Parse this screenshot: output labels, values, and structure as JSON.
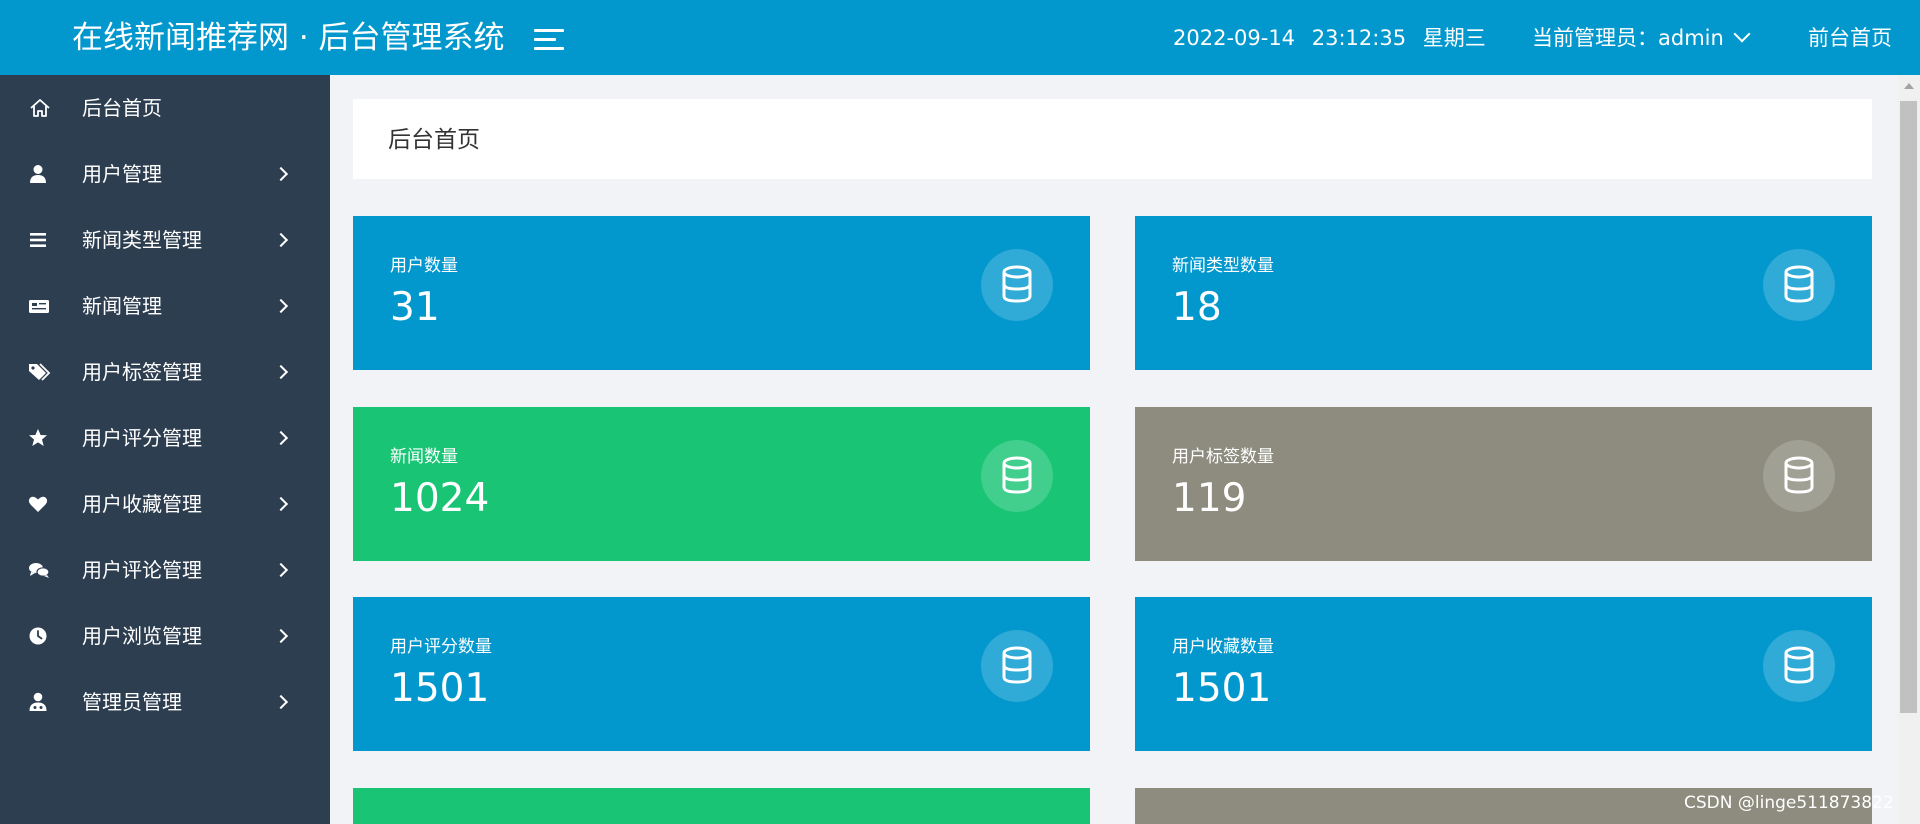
{
  "header": {
    "title": "在线新闻推荐网 · 后台管理系统",
    "date": "2022-09-14",
    "time": "23:12:35",
    "weekday": "星期三",
    "admin_label": "当前管理员：admin",
    "front_link": "前台首页"
  },
  "sidebar": {
    "items": [
      {
        "label": "后台首页",
        "icon": "home-icon"
      },
      {
        "label": "用户管理",
        "icon": "user-icon"
      },
      {
        "label": "新闻类型管理",
        "icon": "list-icon"
      },
      {
        "label": "新闻管理",
        "icon": "newspaper-icon"
      },
      {
        "label": "用户标签管理",
        "icon": "tags-icon"
      },
      {
        "label": "用户评分管理",
        "icon": "star-icon"
      },
      {
        "label": "用户收藏管理",
        "icon": "heart-icon"
      },
      {
        "label": "用户评论管理",
        "icon": "comments-icon"
      },
      {
        "label": "用户浏览管理",
        "icon": "clock-icon"
      },
      {
        "label": "管理员管理",
        "icon": "admin-user-icon"
      }
    ]
  },
  "main": {
    "page_title": "后台首页",
    "cards": [
      {
        "label": "用户数量",
        "value": "31",
        "color": "#0398cd",
        "icon": "database-icon"
      },
      {
        "label": "新闻类型数量",
        "value": "18",
        "color": "#0398cd",
        "icon": "database-icon"
      },
      {
        "label": "新闻数量",
        "value": "1024",
        "color": "#19c574",
        "icon": "database-icon"
      },
      {
        "label": "用户标签数量",
        "value": "119",
        "color": "#8d8c7e",
        "icon": "database-icon"
      },
      {
        "label": "用户评分数量",
        "value": "1501",
        "color": "#0398cd",
        "icon": "database-icon"
      },
      {
        "label": "用户收藏数量",
        "value": "1501",
        "color": "#0398cd",
        "icon": "database-icon"
      }
    ]
  },
  "colors": {
    "header_bg": "#0398cd",
    "sidebar_bg": "#2d3e50",
    "blue": "#0398cd",
    "green": "#19c574",
    "gray": "#8d8c7e"
  },
  "watermark": "CSDN @linge511873822"
}
